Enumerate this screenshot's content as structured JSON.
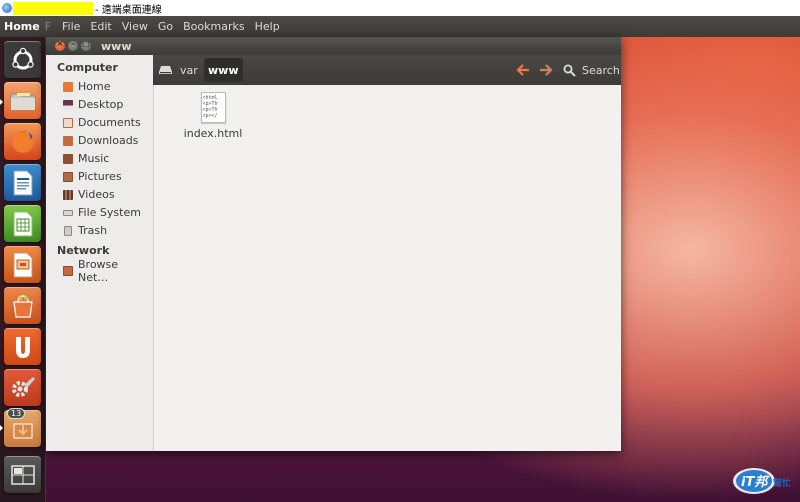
{
  "rdp": {
    "title_suffix": "- 遠端桌面連線"
  },
  "top_panel": {
    "app_name": "Home",
    "app_name_overflow": "F",
    "menus": [
      "File",
      "Edit",
      "View",
      "Go",
      "Bookmarks",
      "Help"
    ]
  },
  "launcher": {
    "items": [
      {
        "name": "dash-home-icon"
      },
      {
        "name": "files-icon",
        "running": true
      },
      {
        "name": "firefox-icon"
      },
      {
        "name": "libreoffice-writer-icon"
      },
      {
        "name": "libreoffice-calc-icon"
      },
      {
        "name": "libreoffice-impress-icon"
      },
      {
        "name": "software-center-icon"
      },
      {
        "name": "ubuntu-one-icon"
      },
      {
        "name": "system-settings-icon"
      },
      {
        "name": "updates-icon",
        "badge": "13"
      },
      {
        "name": "workspace-switcher-icon"
      }
    ]
  },
  "window": {
    "title": "www"
  },
  "sidebar": {
    "computer_header": "Computer",
    "computer_items": [
      {
        "label": "Home",
        "icon": "home-folder-icon",
        "color": "#e8773a"
      },
      {
        "label": "Desktop",
        "icon": "desktop-folder-icon",
        "color": "#6b2f4f"
      },
      {
        "label": "Documents",
        "icon": "documents-folder-icon",
        "color": "#c46a3b"
      },
      {
        "label": "Downloads",
        "icon": "downloads-folder-icon",
        "color": "#c46a3b"
      },
      {
        "label": "Music",
        "icon": "music-folder-icon",
        "color": "#c46a3b"
      },
      {
        "label": "Pictures",
        "icon": "pictures-folder-icon",
        "color": "#c46a3b"
      },
      {
        "label": "Videos",
        "icon": "videos-folder-icon",
        "color": "#c46a3b"
      },
      {
        "label": "File System",
        "icon": "drive-icon",
        "color": "#8d8b86"
      },
      {
        "label": "Trash",
        "icon": "trash-icon",
        "color": "#8d8b86"
      }
    ],
    "network_header": "Network",
    "network_items": [
      {
        "label": "Browse Net…",
        "icon": "network-folder-icon",
        "color": "#c46a3b"
      }
    ]
  },
  "toolbar": {
    "path": [
      "var",
      "www"
    ],
    "search_label": "Search",
    "accent_color": "#f07746"
  },
  "content": {
    "files": [
      {
        "name": "index.html",
        "icon": "html-file-icon",
        "preview": [
          "<html",
          "<p>Th",
          "<p>Th",
          "<p></"
        ]
      }
    ]
  },
  "watermark": {
    "text": "iT邦幫忙"
  }
}
